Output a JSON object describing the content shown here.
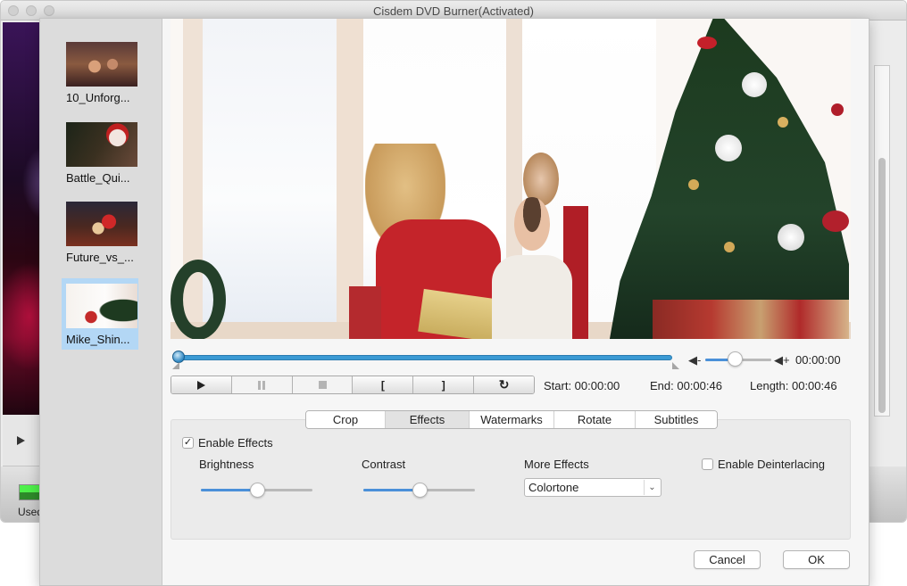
{
  "window": {
    "title": "Cisdem DVD Burner(Activated)",
    "background_status_label": "Used"
  },
  "sidebar": {
    "items": [
      {
        "label": "10_Unforg...",
        "selected": false
      },
      {
        "label": "Battle_Qui...",
        "selected": false
      },
      {
        "label": "Future_vs_...",
        "selected": false
      },
      {
        "label": "Mike_Shin...",
        "selected": true
      }
    ]
  },
  "player": {
    "progress_fraction": 0.0,
    "volume_fraction": 0.45,
    "volume_down_icon": "speaker-minus-icon",
    "volume_up_icon": "speaker-plus-icon",
    "current_time": "00:00:00",
    "start_label": "Start: 00:00:00",
    "end_label": "End: 00:00:46",
    "length_label": "Length: 00:00:46",
    "controls": [
      {
        "name": "play",
        "icon": "play-icon",
        "enabled": true
      },
      {
        "name": "pause",
        "icon": "pause-icon",
        "enabled": false
      },
      {
        "name": "stop",
        "icon": "stop-icon",
        "enabled": false
      },
      {
        "name": "mark-in",
        "glyph": "[",
        "enabled": true
      },
      {
        "name": "mark-out",
        "glyph": "]",
        "enabled": true
      },
      {
        "name": "reset",
        "glyph": "↻",
        "enabled": true
      }
    ]
  },
  "tabs": [
    {
      "label": "Crop",
      "active": false
    },
    {
      "label": "Effects",
      "active": true
    },
    {
      "label": "Watermarks",
      "active": false
    },
    {
      "label": "Rotate",
      "active": false
    },
    {
      "label": "Subtitles",
      "active": false
    }
  ],
  "effects": {
    "enable_effects_label": "Enable Effects",
    "enable_effects_checked": true,
    "check_glyph": "✓",
    "brightness_label": "Brightness",
    "brightness_fraction": 0.5,
    "contrast_label": "Contrast",
    "contrast_fraction": 0.5,
    "more_effects_label": "More Effects",
    "more_effects_value": "Colortone",
    "chevron_glyph": "⌄",
    "deinterlacing_label": "Enable Deinterlacing",
    "deinterlacing_checked": false
  },
  "footer": {
    "cancel_label": "Cancel",
    "ok_label": "OK"
  }
}
